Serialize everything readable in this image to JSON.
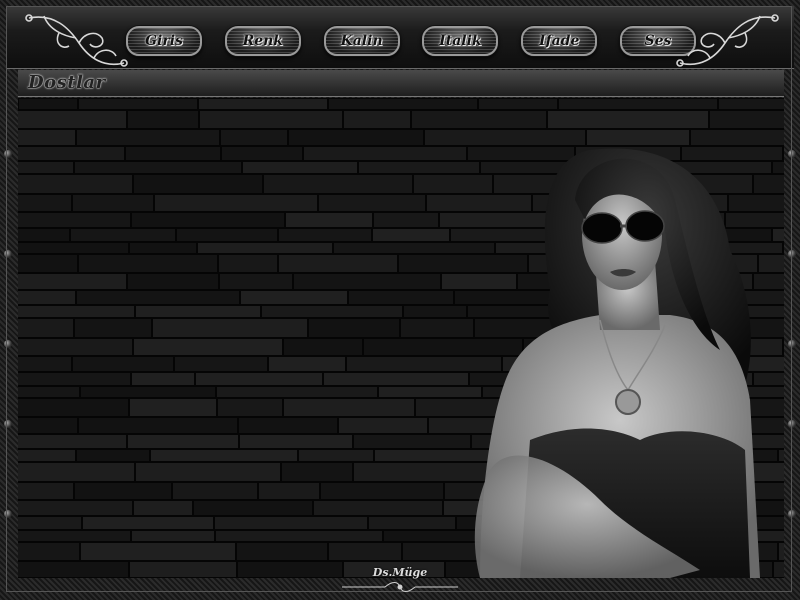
{
  "nav": {
    "buttons": [
      {
        "label": "Giris"
      },
      {
        "label": "Renk"
      },
      {
        "label": "Kalin"
      },
      {
        "label": "Italik"
      },
      {
        "label": "Ifade"
      },
      {
        "label": "Ses"
      }
    ]
  },
  "panel": {
    "title": "Dostlar"
  },
  "footer": {
    "signature": "Ds.Müge"
  },
  "theme": {
    "background": "#0c0c0c",
    "frame": "#1e1e1e",
    "accent": "#9a9a9a"
  }
}
